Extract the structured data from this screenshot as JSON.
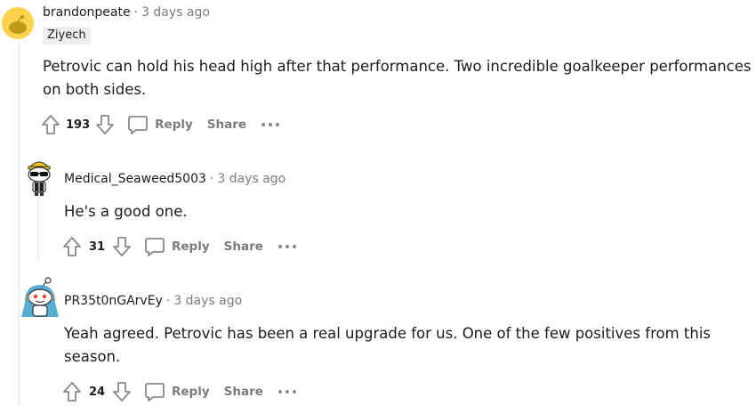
{
  "comments": [
    {
      "username": "brandonpeate",
      "time": "3 days ago",
      "flair": "Ziyech",
      "body_lines": [
        "Petrovic can hold his head high after that performance. Two incredible goalkeeper performances",
        "on both sides."
      ],
      "score": "193",
      "reply_label": "Reply",
      "share_label": "Share",
      "avatar_color": "#fcd34d"
    },
    {
      "username": "Medical_Seaweed5003",
      "time": "3 days ago",
      "body_lines": [
        "He's a good one."
      ],
      "score": "31",
      "reply_label": "Reply",
      "share_label": "Share"
    },
    {
      "username": "PR35t0nGArvEy",
      "time": "3 days ago",
      "body_lines": [
        "Yeah agreed. Petrovic has been a real upgrade for us. One of the few positives from this",
        "season."
      ],
      "score": "24",
      "reply_label": "Reply",
      "share_label": "Share"
    }
  ],
  "separator": "·",
  "colors": {
    "thread_line": "#edeff1",
    "muted": "#7c7c7c",
    "text": "#1c1c1c",
    "flair_bg": "#edeff1"
  }
}
